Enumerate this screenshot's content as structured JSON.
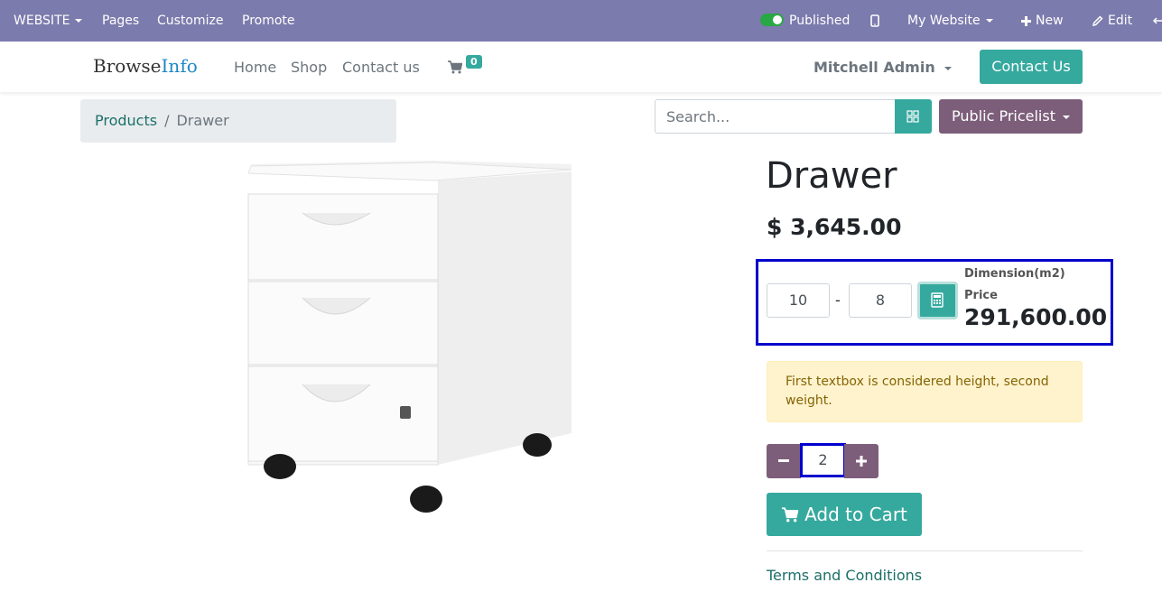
{
  "admin_bar": {
    "website_menu": "WEBSITE",
    "pages": "Pages",
    "customize": "Customize",
    "promote": "Promote",
    "published": "Published",
    "my_website": "My Website",
    "new": "New",
    "edit": "Edit"
  },
  "header": {
    "brand_part1": "Browse",
    "brand_part2": "Info",
    "nav": [
      "Home",
      "Shop",
      "Contact us"
    ],
    "cart_count": "0",
    "user": "Mitchell Admin",
    "contact_button": "Contact Us"
  },
  "breadcrumb": {
    "parent": "Products",
    "separator": "/",
    "current": "Drawer"
  },
  "search": {
    "placeholder": "Search..."
  },
  "pricelist": "Public Pricelist",
  "product": {
    "title": "Drawer",
    "price": "$ 3,645.00",
    "dim_height": "10",
    "dim_separator": "-",
    "dim_weight": "8",
    "dim_label": "Dimension(m2)",
    "price_label": "Price",
    "computed_price": "291,600.00",
    "note": "First textbox is considered height, second weight.",
    "quantity": "2",
    "add_to_cart": "Add to Cart",
    "terms": "Terms and Conditions"
  },
  "colors": {
    "admin_bar": "#7c7bad",
    "accent": "#35a99e",
    "secondary": "#7c5e7a",
    "highlight_border": "#0000cc"
  }
}
